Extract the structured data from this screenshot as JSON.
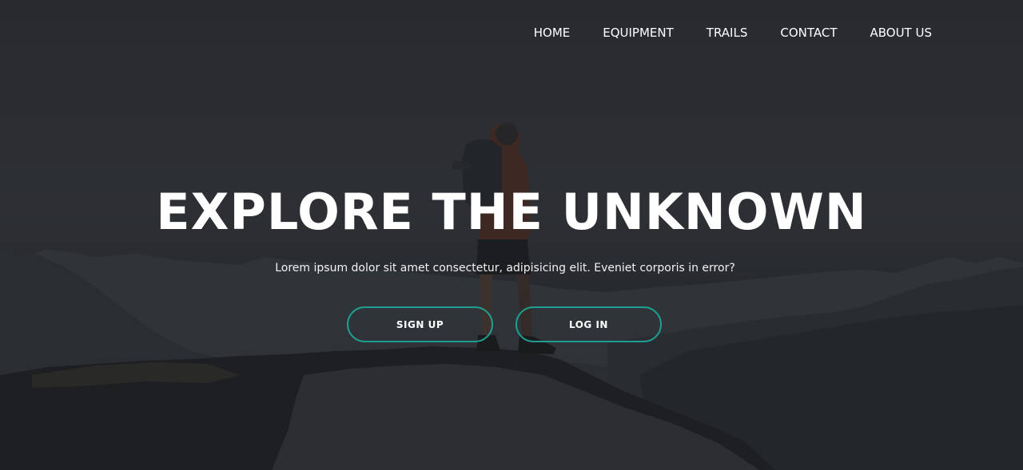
{
  "nav": {
    "items": [
      {
        "label": "HOME"
      },
      {
        "label": "EQUIPMENT"
      },
      {
        "label": "TRAILS"
      },
      {
        "label": "CONTACT"
      },
      {
        "label": "ABOUT US"
      }
    ]
  },
  "hero": {
    "title": "EXPLORE THE UNKNOWN",
    "subtitle": "Lorem ipsum dolor sit amet consectetur, adipisicing elit. Eveniet corporis in error?",
    "signup_label": "SIGN UP",
    "login_label": "LOG IN"
  },
  "colors": {
    "accent": "#1f9e8f",
    "text": "#ffffff",
    "overlay": "#2e3035"
  }
}
